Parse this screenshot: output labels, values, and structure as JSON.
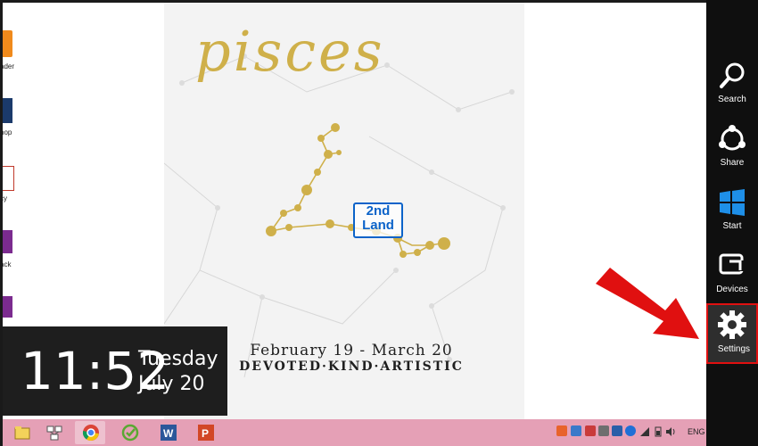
{
  "desktop": {
    "icons": [
      {
        "label": "ader",
        "icon": "pdf-reader-icon",
        "color": "#f08a1c"
      },
      {
        "label": "hop",
        "icon": "photoshop-icon",
        "color": "#1b3a6b"
      },
      {
        "label": "cy",
        "icon": "document-icon",
        "color": "#c0392b"
      },
      {
        "label": "ack",
        "icon": "onenote-icon",
        "color": "#7b2b8f"
      },
      {
        "label": "",
        "icon": "onenote-icon",
        "color": "#7b2b8f"
      }
    ]
  },
  "wallpaper": {
    "title": "pisces",
    "date_range": "February 19 - March 20",
    "traits": "DEVOTED·KIND·ARTISTIC",
    "watermark_line1": "2nd",
    "watermark_line2": "Land",
    "gold_color": "#cfb04a"
  },
  "clock": {
    "time": "11:52",
    "day": "Tuesday",
    "date": "July 20"
  },
  "taskbar": {
    "background": "#e5a0b6",
    "apps": [
      {
        "name": "windows-explorer-icon",
        "active": false
      },
      {
        "name": "network-icon",
        "active": false
      },
      {
        "name": "chrome-icon",
        "active": true
      },
      {
        "name": "greenshot-icon",
        "active": false
      },
      {
        "name": "word-icon",
        "active": false
      },
      {
        "name": "powerpoint-icon",
        "active": false
      }
    ],
    "tray_language": "ENG"
  },
  "charms": [
    {
      "label": "Search",
      "icon": "search-icon"
    },
    {
      "label": "Share",
      "icon": "share-icon"
    },
    {
      "label": "Start",
      "icon": "windows-logo-icon"
    },
    {
      "label": "Devices",
      "icon": "devices-icon"
    },
    {
      "label": "Settings",
      "icon": "gear-icon",
      "selected": true
    }
  ],
  "annotation": {
    "arrow_color": "#e01010"
  }
}
